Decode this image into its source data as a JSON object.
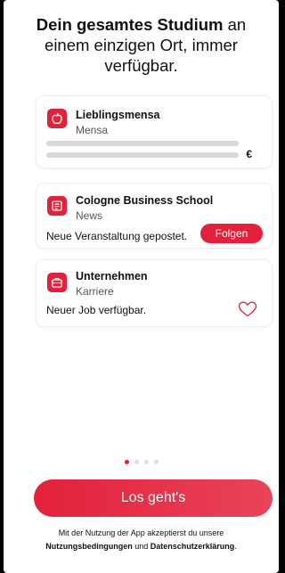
{
  "headline": {
    "bold": "Dein gesamtes Studium",
    "rest": " an einem einzigen Ort, immer verfügbar."
  },
  "cards": [
    {
      "title": "Lieblingsmensa",
      "subtitle": "Mensa",
      "icon": "apple-icon",
      "currency": "€"
    },
    {
      "title": "Cologne Business School",
      "subtitle": "News",
      "icon": "news-icon",
      "text": "Neue Veranstaltung gepostet.",
      "button": "Folgen"
    },
    {
      "title": "Unternehmen",
      "subtitle": "Karriere",
      "icon": "briefcase-icon",
      "text": "Neuer Job verfügbar.",
      "action_icon": "heart-icon"
    }
  ],
  "pager": {
    "count": 4,
    "active": 1
  },
  "cta": {
    "label": "Los geht's"
  },
  "legal": {
    "line1": "Mit der Nutzung der App akzeptierst du unsere",
    "terms": "Nutzungsbedingungen",
    "and": " und ",
    "privacy": "Datenschutzerklärung",
    "end": "."
  },
  "colors": {
    "accent": "#e3213b"
  }
}
